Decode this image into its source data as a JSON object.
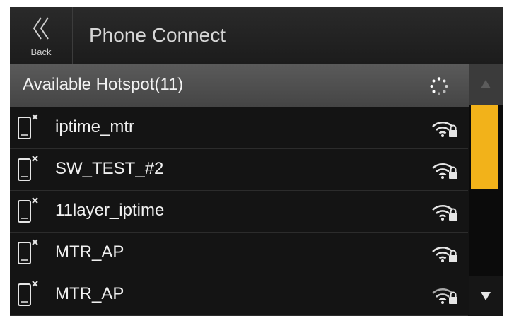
{
  "header": {
    "back_label": "Back",
    "title": "Phone Connect",
    "back_icon": "double-chevron-left-icon"
  },
  "section": {
    "title": "Available Hotspot(11)",
    "spinner_icon": "loading-spinner-icon"
  },
  "hotspots": [
    {
      "name": "iptime_mtr",
      "secured": true
    },
    {
      "name": "SW_TEST_#2",
      "secured": true
    },
    {
      "name": "11layer_iptime",
      "secured": true
    },
    {
      "name": "MTR_AP",
      "secured": true
    },
    {
      "name": "MTR_AP",
      "secured": true
    }
  ],
  "scrollbar": {
    "up_icon": "triangle-up-icon",
    "down_icon": "triangle-down-icon",
    "thumb_color": "#f2b21a"
  },
  "colors": {
    "background": "#141414",
    "accent": "#f2b21a",
    "text": "#f0f0f0"
  }
}
